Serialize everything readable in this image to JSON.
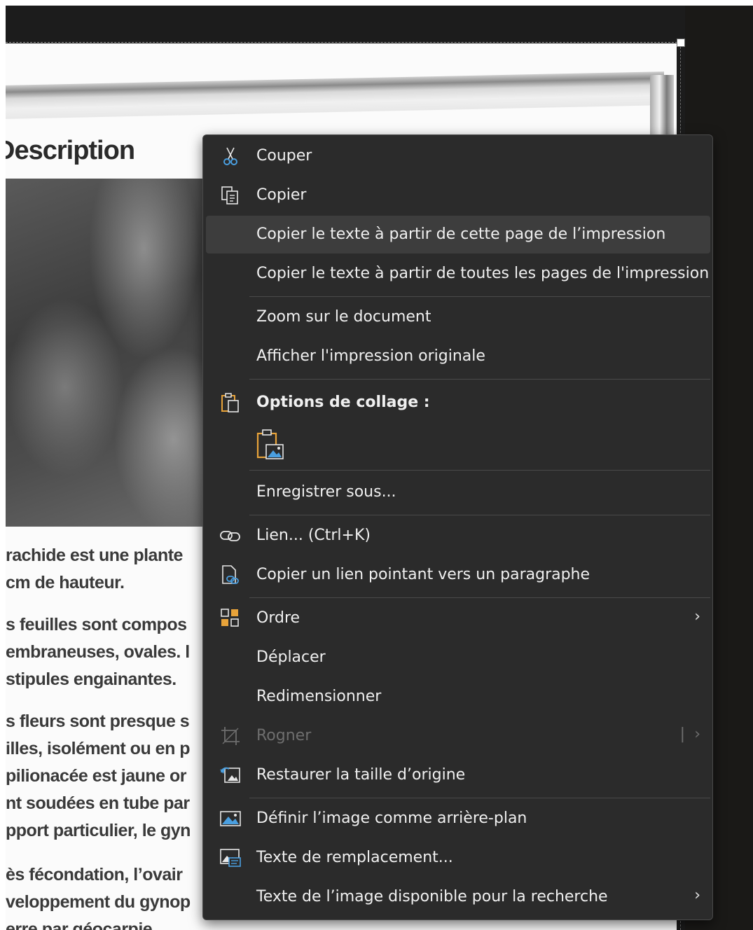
{
  "document": {
    "heading": "Description",
    "paragraphs": [
      [
        "rachide est une plante",
        "cm de hauteur."
      ],
      [
        "s feuilles sont compos",
        "embraneuses, ovales. l",
        "stipules engainantes."
      ],
      [
        "s fleurs sont presque s",
        "illes, isolément ou en p",
        "pilionacée est jaune or",
        "nt soudées en tube par",
        "pport particulier, le gyn"
      ],
      [
        "ès fécondation, l’ovair",
        "veloppement du gynop",
        "erre par géocarpie"
      ]
    ]
  },
  "menu": {
    "items": [
      {
        "id": "cut",
        "label": "Couper",
        "icon": "scissors-icon"
      },
      {
        "id": "copy",
        "label": "Copier",
        "icon": "copy-icon"
      },
      {
        "id": "copy-text-page",
        "label": "Copier le texte à partir de cette page de l’impression",
        "highlighted": true
      },
      {
        "id": "copy-text-all",
        "label": "Copier le texte à partir de toutes les pages de l'impression"
      },
      {
        "id": "zoom",
        "label": "Zoom sur le document"
      },
      {
        "id": "show-original",
        "label": "Afficher l'impression originale"
      },
      {
        "id": "paste-options",
        "label": "Options de collage :",
        "icon": "clipboard-icon"
      },
      {
        "id": "save-as",
        "label": "Enregistrer sous..."
      },
      {
        "id": "link",
        "label": "Lien... (Ctrl+K)",
        "icon": "link-icon"
      },
      {
        "id": "copy-paragraph-link",
        "label": "Copier un lien pointant vers un paragraphe",
        "icon": "paragraph-link-icon"
      },
      {
        "id": "order",
        "label": "Ordre",
        "icon": "arrange-icon",
        "submenu": true
      },
      {
        "id": "move",
        "label": "Déplacer"
      },
      {
        "id": "resize",
        "label": "Redimensionner"
      },
      {
        "id": "crop",
        "label": "Rogner",
        "icon": "crop-icon",
        "disabled": true,
        "submenu": true
      },
      {
        "id": "reset-size",
        "label": "Restaurer la taille d’origine",
        "icon": "reset-size-icon"
      },
      {
        "id": "set-background",
        "label": "Définir l’image comme arrière-plan",
        "icon": "background-image-icon"
      },
      {
        "id": "alt-text",
        "label": "Texte de remplacement...",
        "icon": "alt-text-icon"
      },
      {
        "id": "image-text-search",
        "label": "Texte de l’image disponible pour la recherche",
        "submenu": true
      }
    ],
    "submenu_arrow": "›",
    "split_bar": "|"
  },
  "colors": {
    "menu_bg": "#2b2b2b",
    "menu_text": "#f0f0f0",
    "highlight": "#3d3d3d",
    "disabled_text": "#6e6e6e",
    "icon_accent_orange": "#e8a33a",
    "icon_accent_blue": "#4a9fe0"
  }
}
